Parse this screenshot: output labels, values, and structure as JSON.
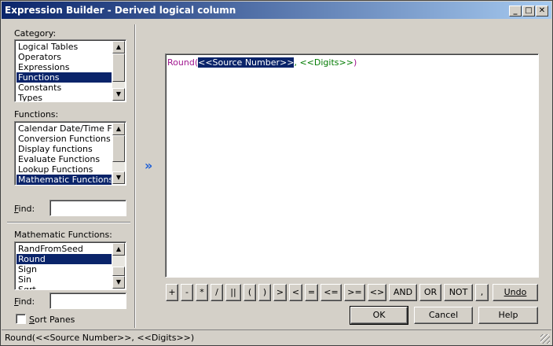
{
  "window": {
    "title": "Expression Builder - Derived logical column"
  },
  "category": {
    "label_prefix": "Category",
    "label_suffix": ":",
    "items": [
      "Logical Tables",
      "Operators",
      "Expressions",
      "Functions",
      "Constants",
      "Types"
    ],
    "selected_index": 3
  },
  "functions": {
    "label_prefix": "Functions",
    "label_suffix": ":",
    "items": [
      "Calendar Date/Time Func",
      "Conversion Functions",
      "Display functions",
      "Evaluate Functions",
      "Lookup Functions",
      "Mathematic Functions"
    ],
    "selected_index": 5
  },
  "find1": {
    "label_u": "F",
    "label_rest": "ind:",
    "value": ""
  },
  "math_functions": {
    "label": "Mathematic Functions:",
    "items": [
      "RandFromSeed",
      "Round",
      "Sign",
      "Sin",
      "Sqrt"
    ],
    "selected_index": 1
  },
  "find2": {
    "label_u": "F",
    "label_rest": "ind:",
    "value": ""
  },
  "sort_panes": {
    "label_u": "S",
    "label_rest": "ort Panes",
    "checked": false
  },
  "editor": {
    "func": "Round",
    "open": "(",
    "arg1": "<<Source Number>>",
    "sep": ", ",
    "arg2": "<<Digits>>",
    "close": ")"
  },
  "operators": [
    "+",
    "-",
    "*",
    "/",
    "||",
    "(",
    ")",
    ">",
    "<",
    "=",
    "<=",
    ">=",
    "<>",
    "AND",
    "OR",
    "NOT",
    ","
  ],
  "buttons": {
    "undo": "Undo",
    "ok": "OK",
    "cancel": "Cancel",
    "help": "Help"
  },
  "status": {
    "text": "Round(<<Source Number>>, <<Digits>>)"
  }
}
